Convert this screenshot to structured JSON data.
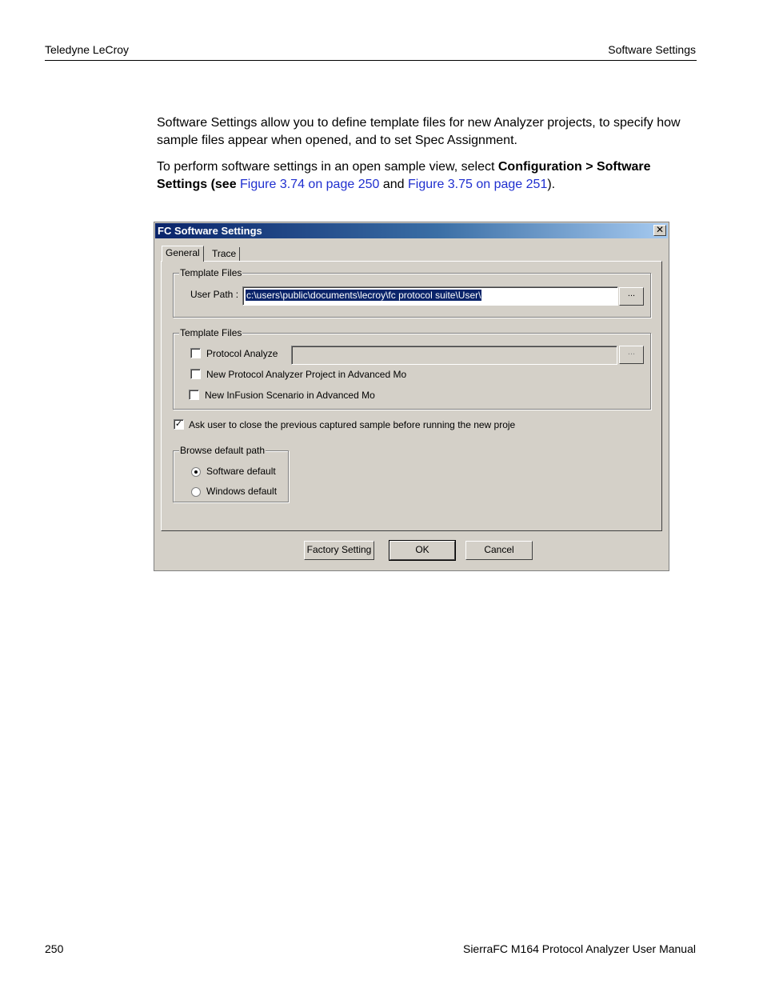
{
  "header": {
    "left": "Teledyne LeCroy",
    "right": "Software Settings"
  },
  "body": {
    "para1": "Software Settings allow you to define template files for new Analyzer projects, to specify how sample files appear when opened, and to set Spec Assignment.",
    "para2_prefix": "To perform software settings in an open sample view, select ",
    "para2_bold": "Configuration > Software Settings (see ",
    "link1": "Figure 3.74 on page 250",
    "and": " and ",
    "link2": "Figure 3.75 on page 251",
    "para2_suffix": ")."
  },
  "dialog": {
    "title": "FC Software Settings",
    "close_label": "✕",
    "tabs": [
      "General",
      "Trace"
    ],
    "group1": {
      "title": "Template Files",
      "user_path_label": "User Path :",
      "user_path_value": "c:\\users\\public\\documents\\lecroy\\fc protocol suite\\User\\",
      "browse_label": "..."
    },
    "group2": {
      "title": "Template Files",
      "items": [
        "Protocol Analyze",
        "New Protocol Analyzer Project in Advanced Mo",
        "New InFusion Scenario in Advanced Mo"
      ],
      "browse_label": "..."
    },
    "ask_user": {
      "label": "Ask user to close the previous captured sample before running the new proje",
      "checked": true,
      "mark": "✓"
    },
    "browse_group": {
      "title": "Browse default path",
      "options": [
        "Software default",
        "Windows default"
      ],
      "selected": "Software default"
    },
    "buttons": {
      "factory": "Factory Setting",
      "ok": "OK",
      "cancel": "Cancel"
    }
  },
  "footer": {
    "left": "250",
    "right": "SierraFC M164 Protocol Analyzer User Manual"
  }
}
